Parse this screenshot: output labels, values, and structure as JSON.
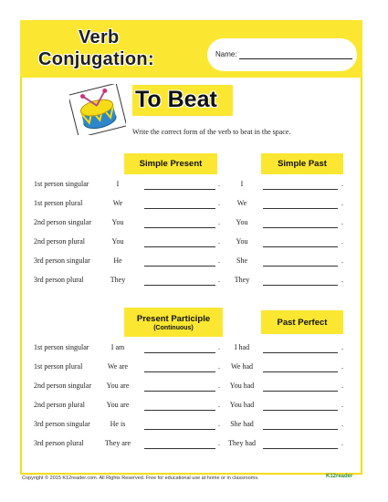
{
  "title": {
    "line1": "Verb",
    "line2": "Conjugation:"
  },
  "name_label": "Name:",
  "verb_title": "To Beat",
  "instruction": "Write the correct form of the verb to beat in the space.",
  "sections": [
    {
      "headers": [
        {
          "main": "Simple Present",
          "sub": ""
        },
        {
          "main": "Simple Past",
          "sub": ""
        }
      ],
      "rows": [
        {
          "person": "1st person singular",
          "left": "I",
          "right": "I"
        },
        {
          "person": "1st person plural",
          "left": "We",
          "right": "We"
        },
        {
          "person": "2nd person singular",
          "left": "You",
          "right": "You"
        },
        {
          "person": "2nd person plural",
          "left": "You",
          "right": "You"
        },
        {
          "person": "3rd person singular",
          "left": "He",
          "right": "She"
        },
        {
          "person": "3rd person plural",
          "left": "They",
          "right": "They"
        }
      ]
    },
    {
      "headers": [
        {
          "main": "Present Participle",
          "sub": "(Continuous)"
        },
        {
          "main": "Past Perfect",
          "sub": ""
        }
      ],
      "rows": [
        {
          "person": "1st person singular",
          "left": "I am",
          "right": "I had"
        },
        {
          "person": "1st person plural",
          "left": "We are",
          "right": "We had"
        },
        {
          "person": "2nd person singular",
          "left": "You are",
          "right": "You had"
        },
        {
          "person": "2nd person plural",
          "left": "You are",
          "right": "You had"
        },
        {
          "person": "3rd person singular",
          "left": "He is",
          "right": "She had"
        },
        {
          "person": "3rd person plural",
          "left": "They are",
          "right": "They had"
        }
      ]
    }
  ],
  "period": ".",
  "footer": "Copyright © 2015 K12reader.com. All Rights Reserved. Free for educational use at home or in classrooms.",
  "logo_text": "K12reader",
  "colors": {
    "accent": "#fbe731",
    "border": "#f5dc17",
    "drum": "#2f86c9"
  }
}
